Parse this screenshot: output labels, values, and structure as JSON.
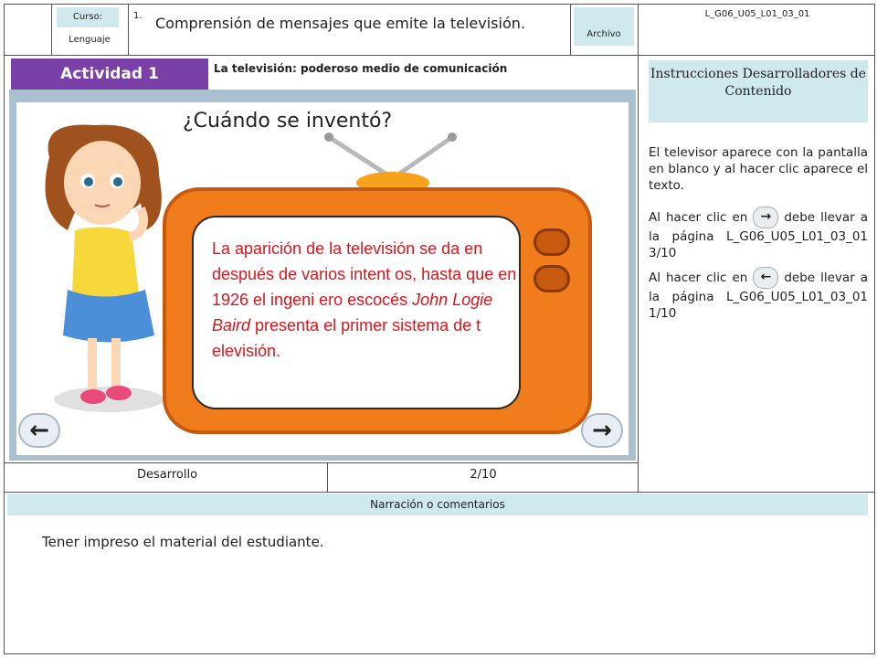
{
  "header": {
    "curso_label": "Curso:",
    "subject": "Lenguaje",
    "number": "1.",
    "title": "Comprensión de mensajes que emite la televisión.",
    "archivo_label": "Archivo",
    "code": "L_G06_U05_L01_03_01"
  },
  "activity": {
    "badge": "Actividad 1",
    "subtitle": "La televisión: poderoso medio de comunicación"
  },
  "slide": {
    "title": "¿Cuándo se inventó?",
    "text_part1": "La aparición de la televisión se da en después de varios intent os, hasta que en 1926 el ingeni ero escocés ",
    "text_italic": "John Logie Baird",
    "text_part2": " presenta el primer sistema de t elevisión.",
    "prev_glyph": "←",
    "next_glyph": "→"
  },
  "instructions": {
    "title": "Instrucciones Desarrolladores de Contenido",
    "p1": "El televisor aparece con la pantalla en blanco y al hacer clic aparece el texto.",
    "p2_pre": "Al hacer clic en",
    "p2_post": "debe llevar a la página L_G06_U05_L01_03_01 3/10",
    "p3_pre": "Al hacer clic en",
    "p3_post": "debe llevar a la página L_G06_U05_L01_03_01 1/10",
    "next_glyph": "→",
    "prev_glyph": "←"
  },
  "footer": {
    "section": "Desarrollo",
    "page": "2/10"
  },
  "narration": {
    "label": "Narración o comentarios",
    "text": "Tener impreso el material del estudiante."
  },
  "colors": {
    "accent_purple": "#7b3fa8",
    "light_blue": "#cfe9ee",
    "tv_orange": "#f07c1c",
    "text_red": "#d8161c"
  }
}
